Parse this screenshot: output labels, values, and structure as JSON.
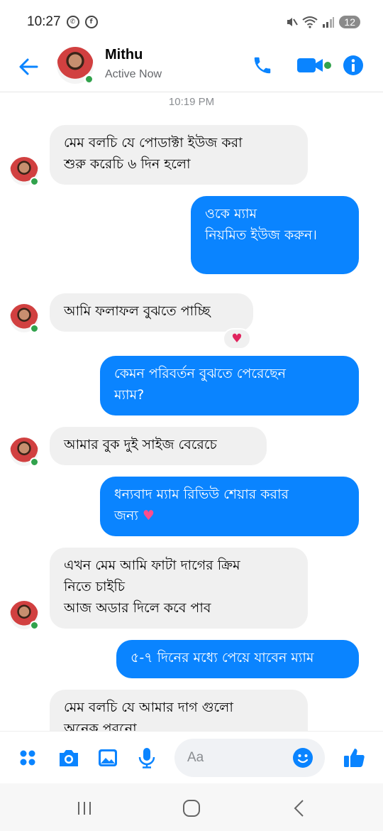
{
  "status_bar": {
    "time": "10:27",
    "battery": "12"
  },
  "header": {
    "contact_name": "Mithu",
    "contact_status": "Active Now"
  },
  "chat": {
    "timestamp": "10:19 PM",
    "messages": [
      {
        "dir": "in",
        "text": "মেম বলচি যে পোডাক্টা ইউজ করা\nশুরু করেচি ৬ দিন হলো"
      },
      {
        "dir": "out",
        "text": "ওকে ম্যাম\nনিয়মিত ইউজ করুন।"
      },
      {
        "dir": "in",
        "text": "আমি ফলাফল বুঝতে পাচ্ছি",
        "reaction": "heart"
      },
      {
        "dir": "out",
        "text": "কেমন পরিবর্তন বুঝতে পেরেছেন\nম্যাম?"
      },
      {
        "dir": "in",
        "text": "আমার বুক দুই সাইজ বেরেচে"
      },
      {
        "dir": "out",
        "text": "ধন্যবাদ ম্যাম রিভিউ শেয়ার করার\nজন্য"
      },
      {
        "dir": "in",
        "text": "এখন মেম আমি ফাটা দাগের ক্রিম\nনিতে চাইচি\nআজ অডার দিলে কবে পাব"
      },
      {
        "dir": "out",
        "text": "৫-৭ দিনের মধ্যে পেয়ে যাবেন ম্যাম"
      },
      {
        "dir": "in",
        "text": "মেম বলচি যে আমার দাগ গুলো\nঅনেক পুরনো"
      }
    ]
  },
  "composer": {
    "placeholder": "Aa"
  },
  "colors": {
    "accent": "#0a84ff",
    "incoming_bubble": "#f0f0f0",
    "online": "#31a24c"
  },
  "icons": {
    "status": [
      "whatsapp-icon",
      "facebook-icon",
      "mute-icon",
      "wifi-icon",
      "signal-icon"
    ],
    "header": [
      "back-arrow-icon",
      "phone-icon",
      "video-call-icon",
      "info-icon"
    ],
    "composer": [
      "menu-dots-icon",
      "camera-icon",
      "gallery-icon",
      "microphone-icon",
      "emoji-icon",
      "thumbs-up-icon"
    ],
    "nav": [
      "recent-apps-icon",
      "home-icon",
      "back-icon"
    ]
  }
}
